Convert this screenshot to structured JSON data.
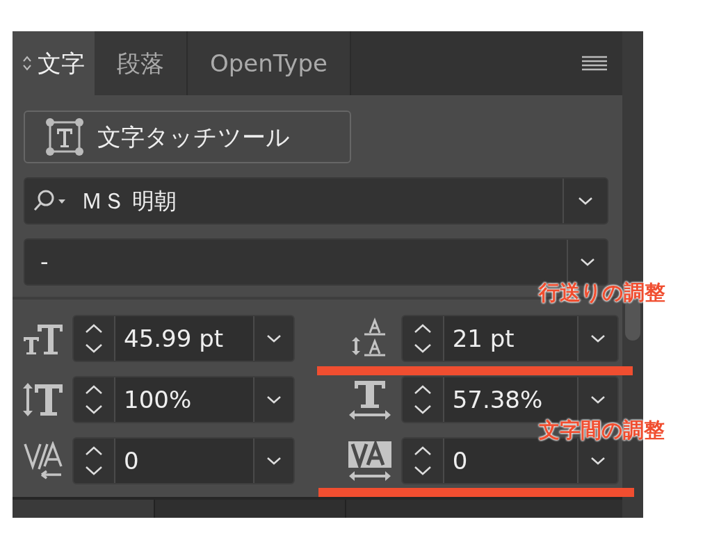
{
  "tabs": [
    {
      "label": "文字",
      "selected": true
    },
    {
      "label": "段落",
      "selected": false
    },
    {
      "label": "OpenType",
      "selected": false
    }
  ],
  "touch_tool_button": {
    "label": "文字タッチツール"
  },
  "font_family": {
    "value": "ＭＳ 明朝"
  },
  "font_style": {
    "value": "-"
  },
  "fields": [
    {
      "kind": "font-size",
      "value": "45.99 pt"
    },
    {
      "kind": "leading",
      "value": "21 pt"
    },
    {
      "kind": "vertical-scale",
      "value": "100%"
    },
    {
      "kind": "horizontal-scale",
      "value": "57.38%"
    },
    {
      "kind": "kerning",
      "value": "0"
    },
    {
      "kind": "tracking",
      "value": "0"
    }
  ],
  "annotations": [
    {
      "text": "行送りの調整"
    },
    {
      "text": "文字間の調整"
    }
  ]
}
